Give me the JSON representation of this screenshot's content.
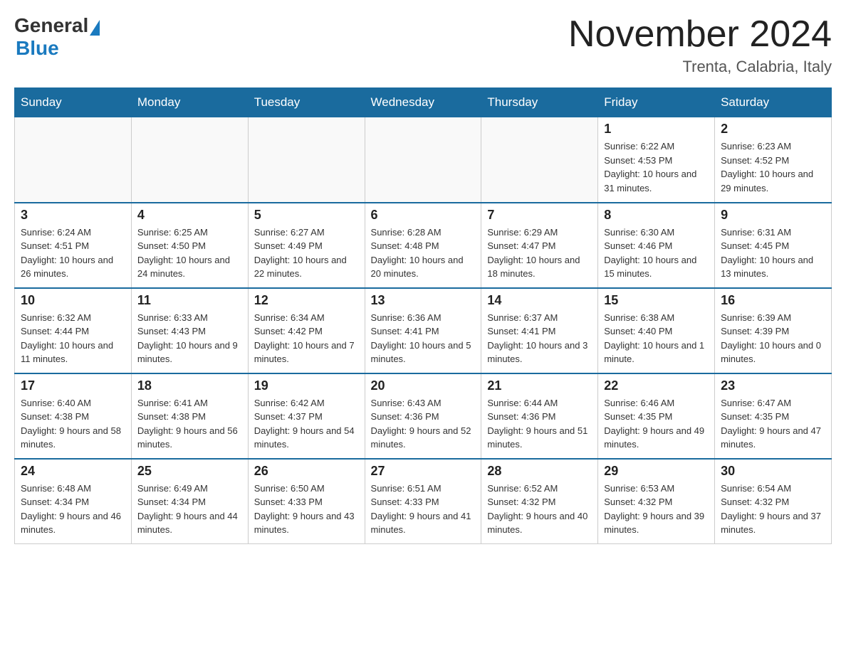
{
  "header": {
    "logo_general": "General",
    "logo_blue": "Blue",
    "month_title": "November 2024",
    "location": "Trenta, Calabria, Italy"
  },
  "weekdays": [
    "Sunday",
    "Monday",
    "Tuesday",
    "Wednesday",
    "Thursday",
    "Friday",
    "Saturday"
  ],
  "weeks": [
    [
      {
        "day": "",
        "info": ""
      },
      {
        "day": "",
        "info": ""
      },
      {
        "day": "",
        "info": ""
      },
      {
        "day": "",
        "info": ""
      },
      {
        "day": "",
        "info": ""
      },
      {
        "day": "1",
        "info": "Sunrise: 6:22 AM\nSunset: 4:53 PM\nDaylight: 10 hours and 31 minutes."
      },
      {
        "day": "2",
        "info": "Sunrise: 6:23 AM\nSunset: 4:52 PM\nDaylight: 10 hours and 29 minutes."
      }
    ],
    [
      {
        "day": "3",
        "info": "Sunrise: 6:24 AM\nSunset: 4:51 PM\nDaylight: 10 hours and 26 minutes."
      },
      {
        "day": "4",
        "info": "Sunrise: 6:25 AM\nSunset: 4:50 PM\nDaylight: 10 hours and 24 minutes."
      },
      {
        "day": "5",
        "info": "Sunrise: 6:27 AM\nSunset: 4:49 PM\nDaylight: 10 hours and 22 minutes."
      },
      {
        "day": "6",
        "info": "Sunrise: 6:28 AM\nSunset: 4:48 PM\nDaylight: 10 hours and 20 minutes."
      },
      {
        "day": "7",
        "info": "Sunrise: 6:29 AM\nSunset: 4:47 PM\nDaylight: 10 hours and 18 minutes."
      },
      {
        "day": "8",
        "info": "Sunrise: 6:30 AM\nSunset: 4:46 PM\nDaylight: 10 hours and 15 minutes."
      },
      {
        "day": "9",
        "info": "Sunrise: 6:31 AM\nSunset: 4:45 PM\nDaylight: 10 hours and 13 minutes."
      }
    ],
    [
      {
        "day": "10",
        "info": "Sunrise: 6:32 AM\nSunset: 4:44 PM\nDaylight: 10 hours and 11 minutes."
      },
      {
        "day": "11",
        "info": "Sunrise: 6:33 AM\nSunset: 4:43 PM\nDaylight: 10 hours and 9 minutes."
      },
      {
        "day": "12",
        "info": "Sunrise: 6:34 AM\nSunset: 4:42 PM\nDaylight: 10 hours and 7 minutes."
      },
      {
        "day": "13",
        "info": "Sunrise: 6:36 AM\nSunset: 4:41 PM\nDaylight: 10 hours and 5 minutes."
      },
      {
        "day": "14",
        "info": "Sunrise: 6:37 AM\nSunset: 4:41 PM\nDaylight: 10 hours and 3 minutes."
      },
      {
        "day": "15",
        "info": "Sunrise: 6:38 AM\nSunset: 4:40 PM\nDaylight: 10 hours and 1 minute."
      },
      {
        "day": "16",
        "info": "Sunrise: 6:39 AM\nSunset: 4:39 PM\nDaylight: 10 hours and 0 minutes."
      }
    ],
    [
      {
        "day": "17",
        "info": "Sunrise: 6:40 AM\nSunset: 4:38 PM\nDaylight: 9 hours and 58 minutes."
      },
      {
        "day": "18",
        "info": "Sunrise: 6:41 AM\nSunset: 4:38 PM\nDaylight: 9 hours and 56 minutes."
      },
      {
        "day": "19",
        "info": "Sunrise: 6:42 AM\nSunset: 4:37 PM\nDaylight: 9 hours and 54 minutes."
      },
      {
        "day": "20",
        "info": "Sunrise: 6:43 AM\nSunset: 4:36 PM\nDaylight: 9 hours and 52 minutes."
      },
      {
        "day": "21",
        "info": "Sunrise: 6:44 AM\nSunset: 4:36 PM\nDaylight: 9 hours and 51 minutes."
      },
      {
        "day": "22",
        "info": "Sunrise: 6:46 AM\nSunset: 4:35 PM\nDaylight: 9 hours and 49 minutes."
      },
      {
        "day": "23",
        "info": "Sunrise: 6:47 AM\nSunset: 4:35 PM\nDaylight: 9 hours and 47 minutes."
      }
    ],
    [
      {
        "day": "24",
        "info": "Sunrise: 6:48 AM\nSunset: 4:34 PM\nDaylight: 9 hours and 46 minutes."
      },
      {
        "day": "25",
        "info": "Sunrise: 6:49 AM\nSunset: 4:34 PM\nDaylight: 9 hours and 44 minutes."
      },
      {
        "day": "26",
        "info": "Sunrise: 6:50 AM\nSunset: 4:33 PM\nDaylight: 9 hours and 43 minutes."
      },
      {
        "day": "27",
        "info": "Sunrise: 6:51 AM\nSunset: 4:33 PM\nDaylight: 9 hours and 41 minutes."
      },
      {
        "day": "28",
        "info": "Sunrise: 6:52 AM\nSunset: 4:32 PM\nDaylight: 9 hours and 40 minutes."
      },
      {
        "day": "29",
        "info": "Sunrise: 6:53 AM\nSunset: 4:32 PM\nDaylight: 9 hours and 39 minutes."
      },
      {
        "day": "30",
        "info": "Sunrise: 6:54 AM\nSunset: 4:32 PM\nDaylight: 9 hours and 37 minutes."
      }
    ]
  ]
}
